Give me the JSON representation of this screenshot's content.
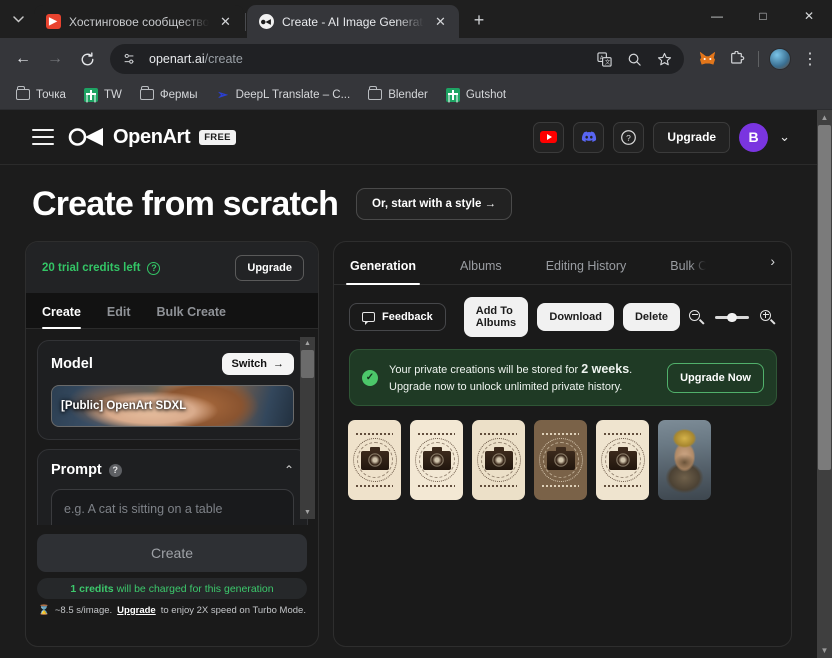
{
  "browser": {
    "tabs": [
      {
        "title": "Хостинговое сообщество «Tim",
        "favicon": "red-play-icon",
        "active": false
      },
      {
        "title": "Create - AI Image Generator | O",
        "favicon": "openart-icon",
        "active": true
      }
    ],
    "new_tab_label": "+",
    "window_controls": {
      "minimize": "—",
      "maximize": "□",
      "close": "✕"
    },
    "nav": {
      "back": "←",
      "forward": "→",
      "reload": "⟳"
    },
    "omnibox": {
      "site_info_icon": "page-settings-icon",
      "url_domain": "openart.ai",
      "url_path": "/create",
      "translate_icon": "translate-icon",
      "search_icon": "search-icon",
      "bookmark_icon": "star-icon"
    },
    "extensions": {
      "metamask": "metamask-fox-icon",
      "puzzle": "extensions-puzzle-icon",
      "menu": "⋮"
    },
    "bookmarks": [
      {
        "label": "Точка",
        "icon": "folder-icon"
      },
      {
        "label": "TW",
        "icon": "sheets-icon"
      },
      {
        "label": "Фермы",
        "icon": "folder-icon"
      },
      {
        "label": "DeepL Translate – C...",
        "icon": "deepl-icon"
      },
      {
        "label": "Blender",
        "icon": "folder-icon"
      },
      {
        "label": "Gutshot",
        "icon": "sheets-icon"
      }
    ]
  },
  "site_header": {
    "menu_icon": "hamburger-menu-icon",
    "logo_text": "OpenArt",
    "plan_badge": "FREE",
    "youtube_icon": "youtube-icon",
    "discord_icon": "discord-icon",
    "help_icon": "help-circle-icon",
    "upgrade_label": "Upgrade",
    "avatar_initial": "B",
    "chevron": "⌄"
  },
  "page_title": {
    "heading": "Create from scratch",
    "style_button": "Or, start with a style →"
  },
  "left_panel": {
    "credits_text": "20 trial credits left",
    "credits_info_icon": "info-circle-icon",
    "credits_upgrade": "Upgrade",
    "tabs": [
      {
        "label": "Create",
        "active": true
      },
      {
        "label": "Edit",
        "active": false
      },
      {
        "label": "Bulk Create",
        "active": false
      }
    ],
    "model": {
      "title": "Model",
      "switch_label": "Switch",
      "switch_arrow": "→",
      "name": "[Public] OpenArt SDXL"
    },
    "prompt": {
      "title": "Prompt",
      "help_icon": "question-circle-icon",
      "collapse_icon": "chevron-up-icon",
      "placeholder": "e.g. A cat is sitting on a table",
      "value": ""
    },
    "create_button": "Create",
    "credit_note_bold": "1 credits",
    "credit_note_rest": "will be charged for this generation",
    "speed_icon": "hourglass-icon",
    "speed_note_pre": "~8.5 s/image.",
    "speed_note_link": "Upgrade",
    "speed_note_post": "to enjoy 2X speed on Turbo Mode."
  },
  "right_panel": {
    "tabs": [
      {
        "label": "Generation",
        "active": true
      },
      {
        "label": "Albums",
        "active": false
      },
      {
        "label": "Editing History",
        "active": false
      },
      {
        "label": "Bulk C",
        "active": false
      }
    ],
    "tabs_next_arrow": "›",
    "toolbar": {
      "feedback_label": "Feedback",
      "feedback_icon": "comment-icon",
      "add_to_albums": "Add To Albums",
      "download": "Download",
      "delete": "Delete",
      "zoom_out_icon": "zoom-out-icon",
      "zoom_in_icon": "zoom-in-icon",
      "zoom_slider_value": 38
    },
    "banner": {
      "check_icon": "check-circle-icon",
      "text_pre": "Your private creations will be stored for",
      "text_bold": "2 weeks",
      "text_post": ". Upgrade now to unlock unlimited private history.",
      "button": "Upgrade Now"
    },
    "thumbnails": [
      {
        "kind": "stamp",
        "bg": "#efe2cb"
      },
      {
        "kind": "stamp",
        "bg": "#f3e8d4"
      },
      {
        "kind": "stamp",
        "bg": "#ece0c8"
      },
      {
        "kind": "stamp",
        "bg": "#7a6248"
      },
      {
        "kind": "stamp",
        "bg": "#efe4cf"
      },
      {
        "kind": "portrait",
        "bg": "#6b7a85"
      }
    ]
  },
  "colors": {
    "page_bg": "#1c1c1c",
    "panel_bg": "#1a1a1a",
    "accent_green": "#33c566",
    "accent_purple": "#7a35e0",
    "banner_bg": "#1f3a25"
  }
}
